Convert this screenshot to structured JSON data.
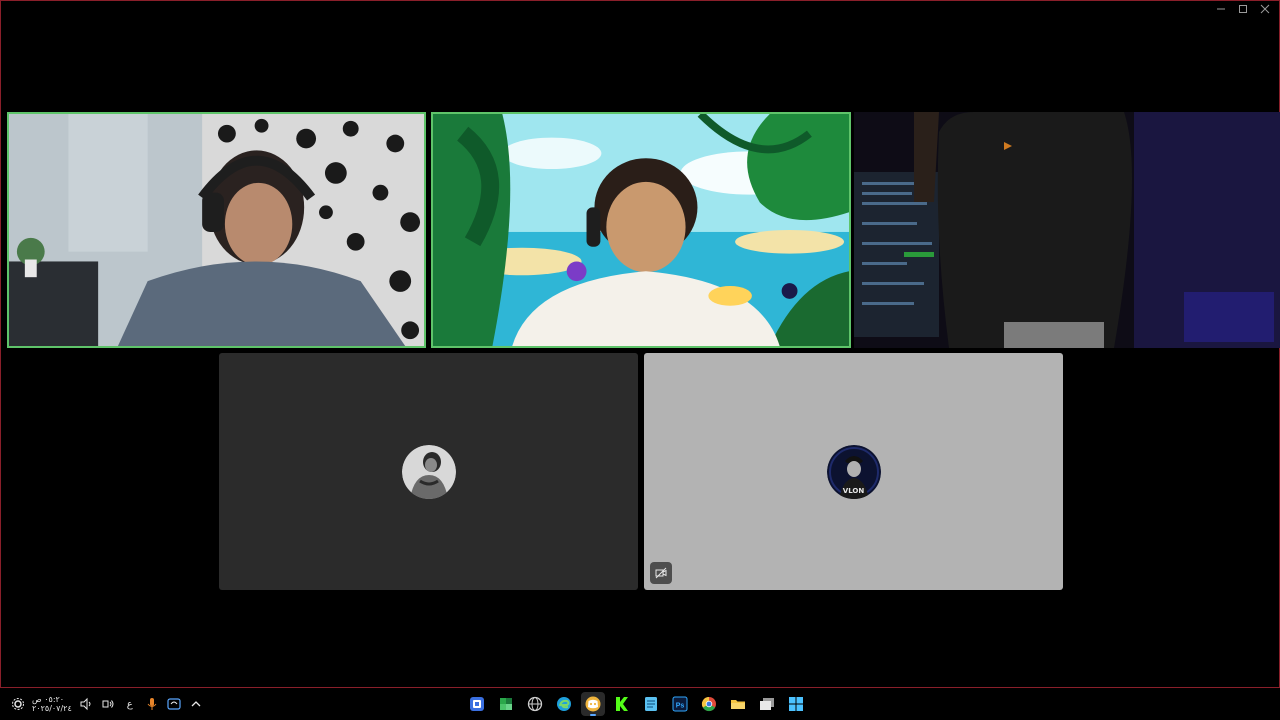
{
  "taskbar": {
    "clock": {
      "time": "٠٥:٢٠ ص",
      "date": "٢٠٢٥/٠٧/٢٤"
    },
    "language": "ع",
    "apps": [
      {
        "icon": "store-icon"
      },
      {
        "icon": "snip-icon"
      },
      {
        "icon": "globe-icon"
      },
      {
        "icon": "edge-icon"
      },
      {
        "icon": "discord-icon",
        "active": true
      },
      {
        "icon": "kick-icon"
      },
      {
        "icon": "notepad-icon"
      },
      {
        "icon": "photoshop-icon",
        "label": "Ps"
      },
      {
        "icon": "chrome-icon"
      },
      {
        "icon": "folder-icon"
      },
      {
        "icon": "window-icon"
      },
      {
        "icon": "windows-start-icon"
      }
    ]
  },
  "participants": [
    {
      "tile": "video",
      "speaking": true
    },
    {
      "tile": "video",
      "speaking": true
    },
    {
      "tile": "video",
      "speaking": false
    },
    {
      "tile": "avatar",
      "bg": "#2b2b2b"
    },
    {
      "tile": "avatar",
      "bg": "#b3b3b3",
      "avatar_text": "VLON",
      "media_off": true
    }
  ],
  "colors": {
    "speaking_border": "#5fc46a",
    "window_border": "#8a1f2a",
    "accent": "#5aa7ff"
  }
}
